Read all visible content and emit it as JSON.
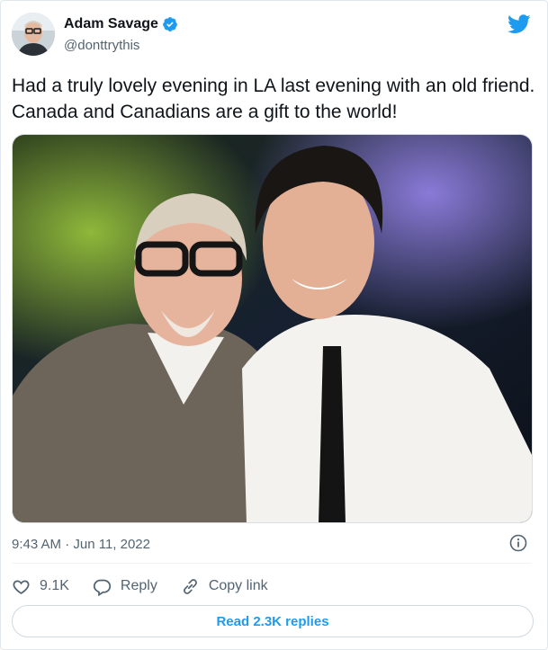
{
  "author": {
    "display_name": "Adam Savage",
    "handle": "@donttrythis",
    "verified": true
  },
  "tweet": {
    "text": "Had a truly lovely evening in LA last evening with an old friend. Canada and Canadians are a gift to the world!",
    "timestamp": "9:43 AM · Jun 11, 2022"
  },
  "actions": {
    "like_count": "9.1K",
    "reply_label": "Reply",
    "copy_link_label": "Copy link"
  },
  "replies_button": {
    "label": "Read 2.3K replies"
  },
  "icons": {
    "verified": "verified-badge-icon",
    "logo": "twitter-bird-icon",
    "info": "info-icon",
    "like": "heart-icon",
    "reply": "speech-bubble-icon",
    "copy_link": "link-icon"
  },
  "colors": {
    "brand_blue": "#1d9bf0",
    "text_primary": "#0f1419",
    "text_secondary": "#536471",
    "border": "#cfd9de"
  }
}
